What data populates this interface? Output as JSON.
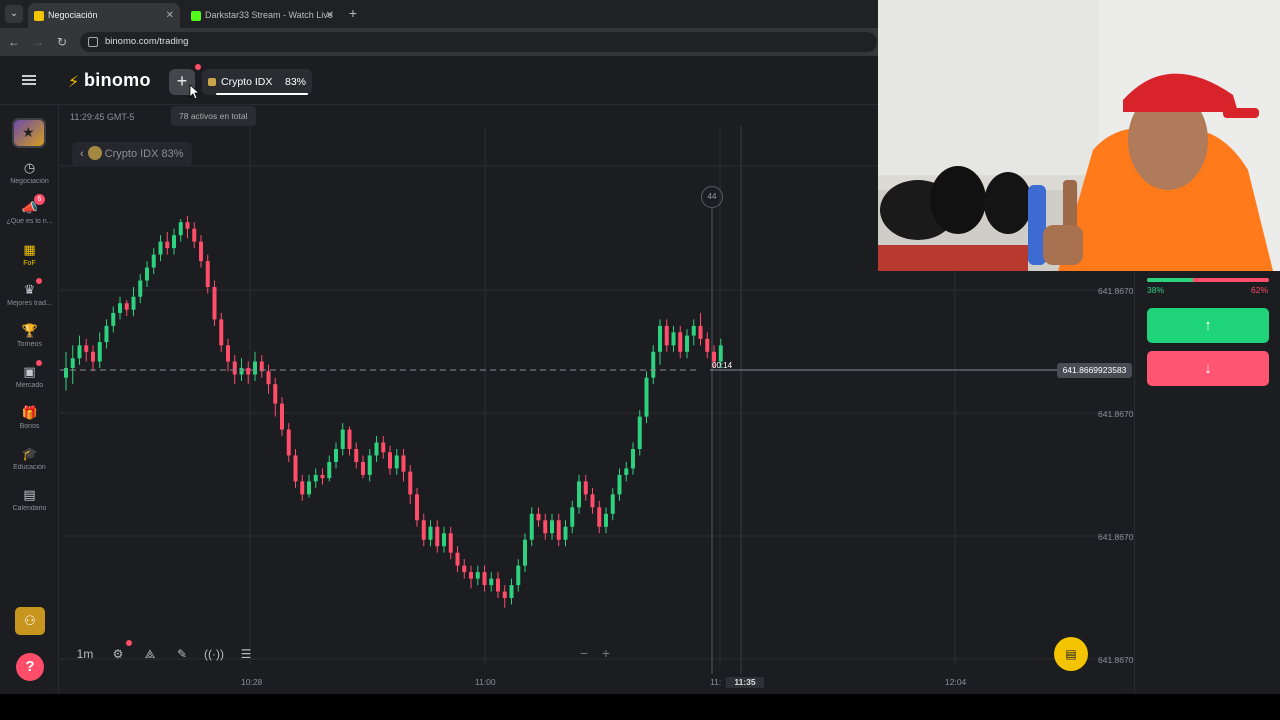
{
  "browser": {
    "tabs": [
      {
        "label": "Negociación",
        "active": true
      },
      {
        "label": "Darkstar33 Stream - Watch Live",
        "active": false
      }
    ],
    "url": "binomo.com/trading"
  },
  "header": {
    "logo": "binomo",
    "add_tooltip": "78 activos en total",
    "asset_tab": {
      "name": "Crypto IDX",
      "payout": "83%"
    }
  },
  "sidebar": {
    "items": [
      {
        "label": "Negociación",
        "icon": "clock-icon",
        "glyph": "◷",
        "active": false
      },
      {
        "label": "¿Qué es lo n...",
        "icon": "megaphone-icon",
        "glyph": "📣",
        "active": false,
        "badge": "6"
      },
      {
        "label": "FoF",
        "icon": "fof-icon",
        "glyph": "▦",
        "active": true
      },
      {
        "label": "Mejores trad...",
        "icon": "top-traders-icon",
        "glyph": "♛",
        "active": false,
        "dot": true
      },
      {
        "label": "Torneos",
        "icon": "trophy-icon",
        "glyph": "🏆",
        "active": false
      },
      {
        "label": "Mercado",
        "icon": "shopping-bag-icon",
        "glyph": "▣",
        "active": false,
        "dot": true
      },
      {
        "label": "Bonos",
        "icon": "gift-icon",
        "glyph": "🎁",
        "active": false
      },
      {
        "label": "Educación",
        "icon": "graduation-cap-icon",
        "glyph": "🎓",
        "active": false
      },
      {
        "label": "Calendario",
        "icon": "calendar-icon",
        "glyph": "▤",
        "active": false
      }
    ],
    "help_glyph": "?"
  },
  "chart": {
    "clock": "11:29:45 GMT-5",
    "asset_chip": "Crypto IDX 83%",
    "current_price": "641.8669923583",
    "timer": "00:14",
    "time_marker": "44",
    "y_ticks": [
      "641.8670",
      "641.8670",
      "641.8670",
      "641.8670"
    ],
    "x_ticks": [
      "10:28",
      "11:00",
      "11:",
      "12:04"
    ],
    "x_now": "11:35",
    "toolbar": {
      "timeframe": "1m"
    }
  },
  "chart_data": {
    "type": "candlestick",
    "title": "",
    "ylim": [
      0,
      100
    ],
    "candles": [
      [
        42,
        45,
        38,
        50
      ],
      [
        45,
        48,
        40,
        52
      ],
      [
        48,
        52,
        46,
        55
      ],
      [
        52,
        50,
        47,
        54
      ],
      [
        50,
        47,
        44,
        52
      ],
      [
        47,
        53,
        45,
        56
      ],
      [
        53,
        58,
        51,
        60
      ],
      [
        58,
        62,
        56,
        64
      ],
      [
        62,
        65,
        60,
        67
      ],
      [
        65,
        63,
        61,
        66
      ],
      [
        63,
        67,
        61,
        70
      ],
      [
        67,
        72,
        65,
        74
      ],
      [
        72,
        76,
        70,
        78
      ],
      [
        76,
        80,
        74,
        82
      ],
      [
        80,
        84,
        78,
        86
      ],
      [
        84,
        82,
        80,
        87
      ],
      [
        82,
        86,
        80,
        88
      ],
      [
        86,
        90,
        84,
        91
      ],
      [
        90,
        88,
        85,
        92
      ],
      [
        88,
        84,
        82,
        90
      ],
      [
        84,
        78,
        76,
        86
      ],
      [
        78,
        70,
        68,
        80
      ],
      [
        70,
        60,
        58,
        72
      ],
      [
        60,
        52,
        50,
        62
      ],
      [
        52,
        47,
        44,
        54
      ],
      [
        47,
        43,
        40,
        49
      ],
      [
        43,
        45,
        41,
        48
      ],
      [
        45,
        43,
        40,
        47
      ],
      [
        43,
        47,
        41,
        50
      ],
      [
        47,
        44,
        42,
        49
      ],
      [
        44,
        40,
        37,
        46
      ],
      [
        40,
        34,
        30,
        42
      ],
      [
        34,
        26,
        24,
        36
      ],
      [
        26,
        18,
        16,
        28
      ],
      [
        18,
        10,
        8,
        20
      ],
      [
        10,
        6,
        4,
        12
      ],
      [
        6,
        10,
        5,
        12
      ],
      [
        10,
        12,
        8,
        14
      ],
      [
        12,
        11,
        9,
        14
      ],
      [
        11,
        16,
        10,
        18
      ],
      [
        16,
        20,
        14,
        22
      ],
      [
        20,
        26,
        18,
        28
      ],
      [
        26,
        20,
        18,
        27
      ],
      [
        20,
        16,
        14,
        22
      ],
      [
        16,
        12,
        11,
        18
      ],
      [
        12,
        18,
        10,
        20
      ],
      [
        18,
        22,
        16,
        24
      ],
      [
        22,
        19,
        17,
        24
      ],
      [
        19,
        14,
        12,
        21
      ],
      [
        14,
        18,
        12,
        20
      ],
      [
        18,
        13,
        10,
        20
      ],
      [
        13,
        6,
        3,
        15
      ],
      [
        6,
        -2,
        -4,
        8
      ],
      [
        -2,
        -8,
        -10,
        0
      ],
      [
        -8,
        -4,
        -10,
        -2
      ],
      [
        -4,
        -10,
        -12,
        -2
      ],
      [
        -10,
        -6,
        -12,
        -4
      ],
      [
        -6,
        -12,
        -14,
        -4
      ],
      [
        -12,
        -16,
        -18,
        -10
      ],
      [
        -16,
        -18,
        -20,
        -14
      ],
      [
        -18,
        -20,
        -23,
        -16
      ],
      [
        -20,
        -18,
        -22,
        -16
      ],
      [
        -18,
        -22,
        -24,
        -16
      ],
      [
        -22,
        -20,
        -24,
        -18
      ],
      [
        -20,
        -24,
        -26,
        -18
      ],
      [
        -24,
        -26,
        -29,
        -22
      ],
      [
        -26,
        -22,
        -28,
        -20
      ],
      [
        -22,
        -16,
        -24,
        -14
      ],
      [
        -16,
        -8,
        -18,
        -6
      ],
      [
        -8,
        0,
        -10,
        2
      ],
      [
        0,
        -2,
        -4,
        2
      ],
      [
        -2,
        -6,
        -8,
        0
      ],
      [
        -6,
        -2,
        -8,
        0
      ],
      [
        -2,
        -8,
        -10,
        0
      ],
      [
        -8,
        -4,
        -10,
        -2
      ],
      [
        -4,
        2,
        -6,
        4
      ],
      [
        2,
        10,
        0,
        12
      ],
      [
        10,
        6,
        4,
        12
      ],
      [
        6,
        2,
        0,
        8
      ],
      [
        2,
        -4,
        -6,
        4
      ],
      [
        -4,
        0,
        -6,
        2
      ],
      [
        0,
        6,
        -2,
        8
      ],
      [
        6,
        12,
        4,
        14
      ],
      [
        12,
        14,
        10,
        16
      ],
      [
        14,
        20,
        12,
        22
      ],
      [
        20,
        30,
        18,
        32
      ],
      [
        30,
        42,
        28,
        44
      ],
      [
        42,
        50,
        40,
        52
      ],
      [
        50,
        58,
        46,
        60
      ],
      [
        58,
        52,
        50,
        60
      ],
      [
        52,
        56,
        50,
        58
      ],
      [
        56,
        50,
        48,
        58
      ],
      [
        50,
        55,
        48,
        57
      ],
      [
        55,
        58,
        52,
        60
      ],
      [
        58,
        54,
        52,
        62
      ],
      [
        54,
        50,
        48,
        56
      ],
      [
        50,
        47,
        45,
        52
      ],
      [
        47,
        52,
        45,
        54
      ]
    ]
  },
  "right_panel": {
    "up_pct": "38%",
    "down_pct": "62%",
    "up_fraction": 0.38
  }
}
